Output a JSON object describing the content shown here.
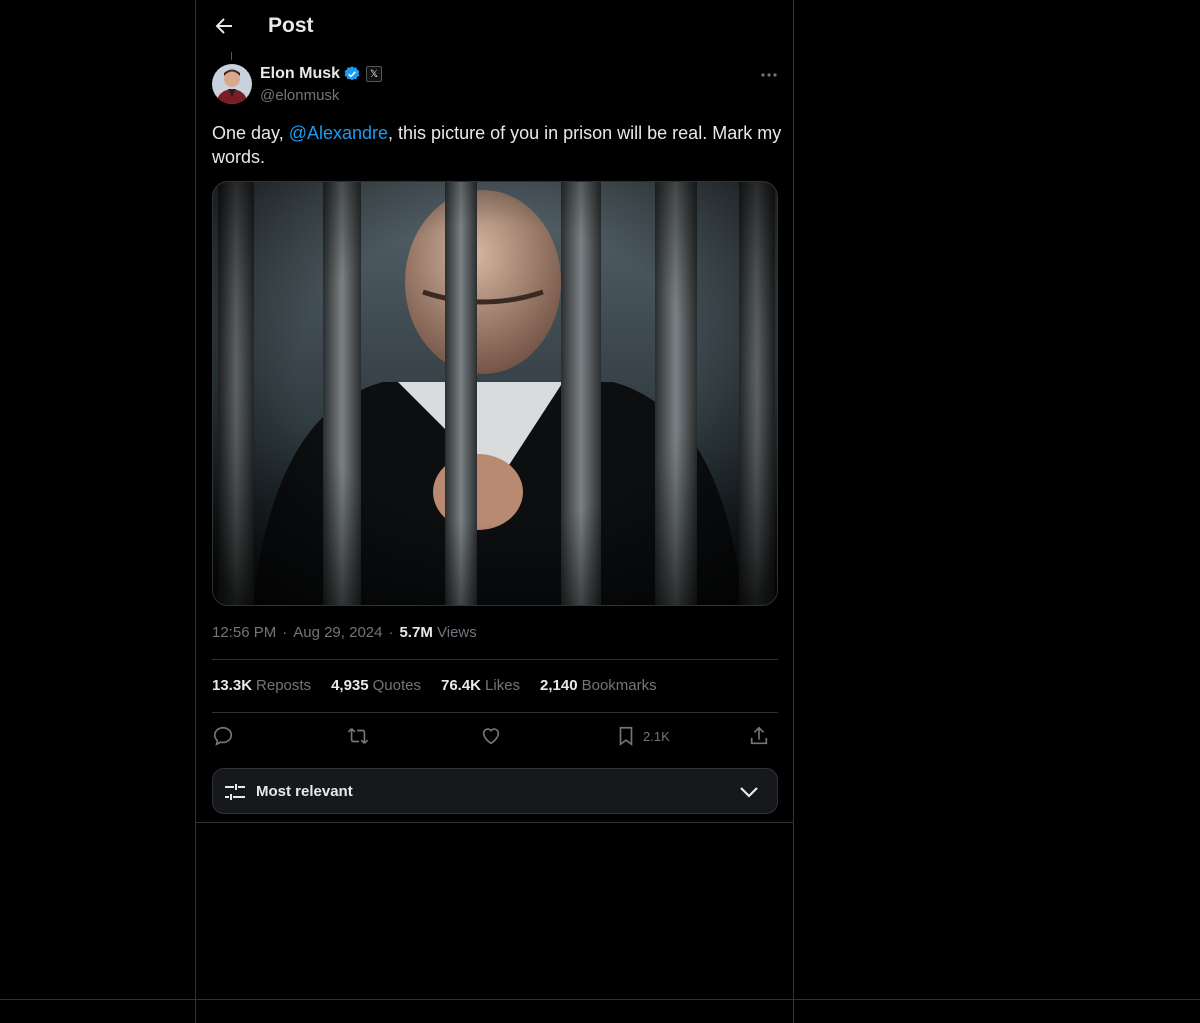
{
  "header": {
    "title": "Post"
  },
  "author": {
    "name": "Elon Musk",
    "handle": "@elonmusk",
    "badge_glyph": "𝕏"
  },
  "tweet": {
    "text_before": "One day, ",
    "mention": "@Alexandre",
    "text_after": ", this picture of you in prison will be real. Mark my words."
  },
  "meta": {
    "time": "12:56 PM",
    "date": "Aug 29, 2024",
    "views_count": "5.7M",
    "views_label": "Views",
    "sep": "·"
  },
  "stats": [
    {
      "count": "13.3K",
      "label": "Reposts"
    },
    {
      "count": "4,935",
      "label": "Quotes"
    },
    {
      "count": "76.4K",
      "label": "Likes"
    },
    {
      "count": "2,140",
      "label": "Bookmarks"
    }
  ],
  "actions": {
    "bookmark_count": "2.1K"
  },
  "sort": {
    "label": "Most relevant"
  },
  "colors": {
    "accent": "#1d9bf0",
    "muted": "#71767b",
    "text": "#e7e9ea",
    "border": "#2f3336"
  },
  "icons": [
    "back-arrow-icon",
    "verified-badge-icon",
    "x-affiliate-icon",
    "more-icon",
    "reply-icon",
    "repost-icon",
    "like-icon",
    "bookmark-icon",
    "share-icon",
    "sliders-icon",
    "chevron-down-icon"
  ]
}
